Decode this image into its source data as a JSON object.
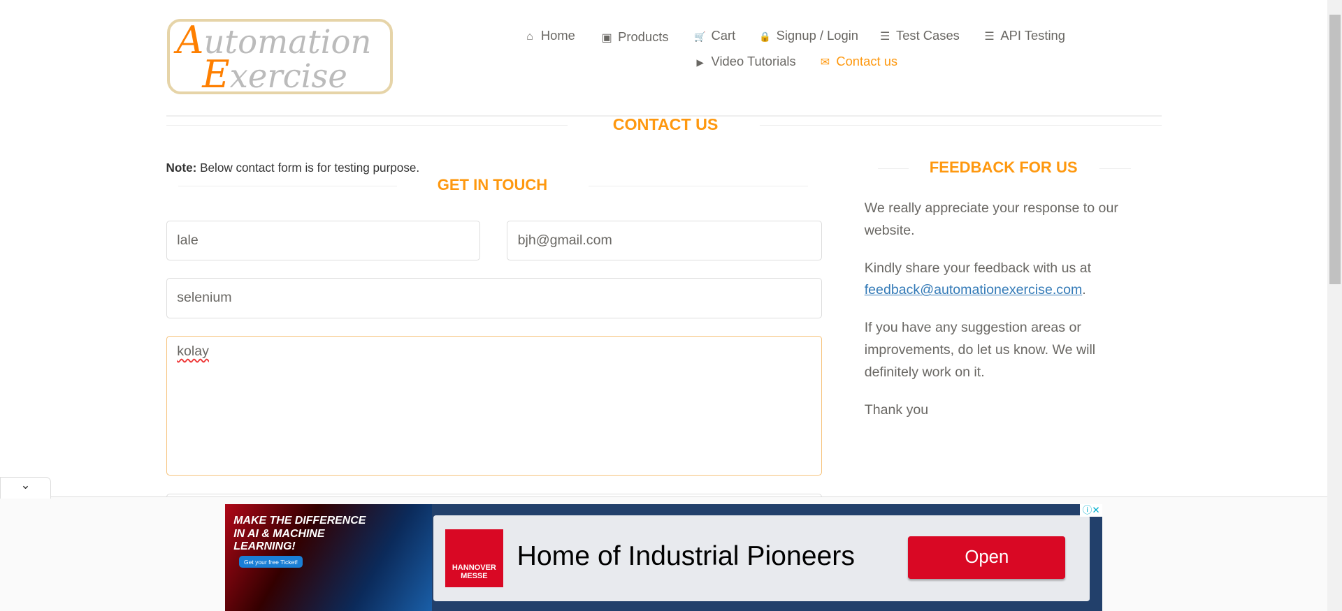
{
  "logo": {
    "line1_first": "A",
    "line1_rest": "utomation",
    "line2_first": "E",
    "line2_rest": "xercise"
  },
  "nav": [
    {
      "label": "Home",
      "icon": "home-icon",
      "glyph": "⌂"
    },
    {
      "label": "Products",
      "icon": "briefcase-icon",
      "glyph": "▣"
    },
    {
      "label": "Cart",
      "icon": "cart-icon",
      "glyph": "🛒"
    },
    {
      "label": "Signup / Login",
      "icon": "lock-icon",
      "glyph": "🔒"
    },
    {
      "label": "Test Cases",
      "icon": "list-icon",
      "glyph": "☰"
    },
    {
      "label": "API Testing",
      "icon": "list-icon",
      "glyph": "☰"
    },
    {
      "label": "Video Tutorials",
      "icon": "youtube-icon",
      "glyph": "▶"
    },
    {
      "label": "Contact us",
      "icon": "envelope-icon",
      "glyph": "✉"
    }
  ],
  "contact_title": "CONTACT US",
  "note_label": "Note:",
  "note_text": " Below contact form is for testing purpose.",
  "get_in_touch": "GET IN TOUCH",
  "form": {
    "name": "lale",
    "email": "bjh@gmail.com",
    "subject": "selenium",
    "message": "kolay"
  },
  "feedback": {
    "title": "FEEDBACK FOR US",
    "p1": "We really appreciate your response to our website.",
    "p2_pre": "Kindly share your feedback with us at ",
    "email": "feedback@automationexercise.com",
    "p2_post": ".",
    "p3": "If you have any suggestion areas or improvements, do let us know. We will definitely work on it.",
    "p4": "Thank you"
  },
  "ad": {
    "left_headline": "MAKE THE DIFFERENCE IN AI & MACHINE LEARNING!",
    "left_cta": "Get your free Ticket!",
    "brand": "HANNOVER MESSE",
    "headline": "Home of Industrial Pioneers",
    "button": "Open"
  },
  "colors": {
    "accent": "#fe980f",
    "ad_red": "#d90824",
    "ad_navy": "#22406b"
  }
}
